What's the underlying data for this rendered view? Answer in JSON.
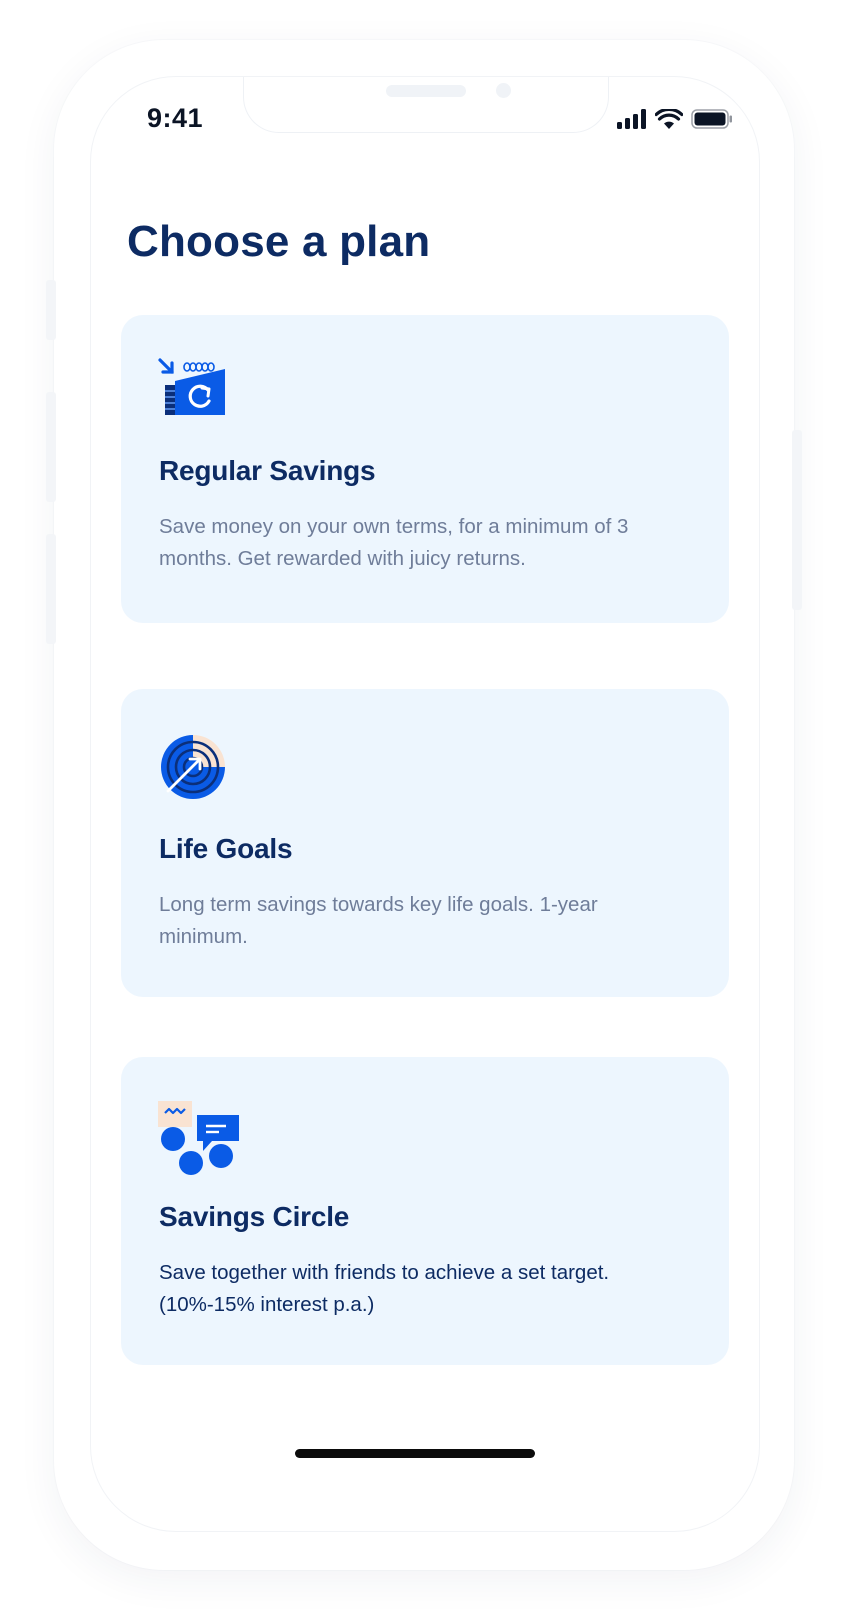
{
  "status_bar": {
    "time": "9:41"
  },
  "page": {
    "title": "Choose a plan"
  },
  "plans": [
    {
      "title": "Regular Savings",
      "description": "Save money on your own terms, for a minimum of 3 months. Get rewarded with juicy returns.",
      "icon": "calendar-refresh-icon"
    },
    {
      "title": "Life Goals",
      "description": "Long term savings towards key life goals. 1-year minimum.",
      "icon": "target-arrow-icon"
    },
    {
      "title": "Savings Circle",
      "description": "Save together with friends to achieve a set target. (10%-15% interest p.a.)",
      "icon": "group-chat-icon"
    }
  ],
  "colors": {
    "primary_blue": "#0A5BE6",
    "title_navy": "#0D2B63",
    "card_background": "#EDF6FE",
    "description_gray": "#6F7D99",
    "accent_peach": "#F9E3D2"
  }
}
